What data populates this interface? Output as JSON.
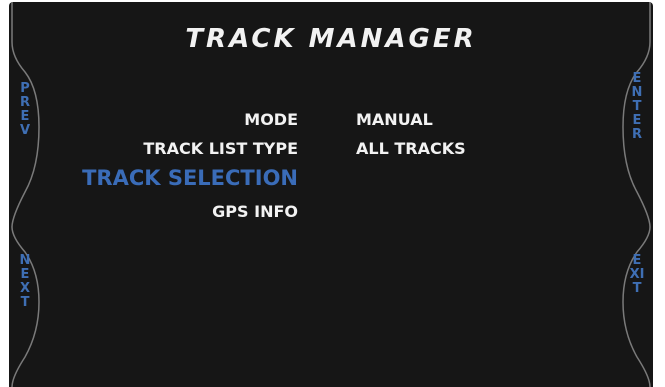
{
  "screen": {
    "title": "TRACK MANAGER",
    "accent_color": "#3a6cb8",
    "background_color": "#161616"
  },
  "side_buttons": {
    "prev": "PREV",
    "next": "NEXT",
    "enter": "ENTER",
    "exit": "EXIT"
  },
  "menu": [
    {
      "label": "MODE",
      "value": "MANUAL",
      "selected": false
    },
    {
      "label": "TRACK LIST TYPE",
      "value": "ALL TRACKS",
      "selected": false
    },
    {
      "label": "TRACK SELECTION",
      "value": "",
      "selected": true
    },
    {
      "label": "GPS INFO",
      "value": "",
      "selected": false
    }
  ]
}
